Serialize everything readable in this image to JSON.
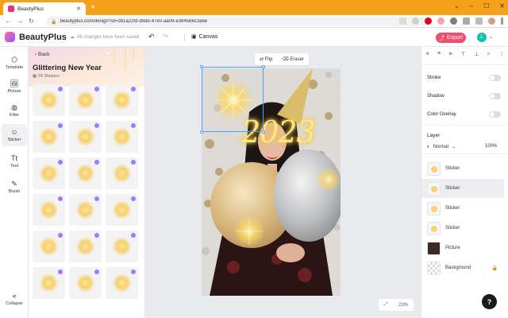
{
  "browser": {
    "tab_title": "BeautyPlus",
    "url": "beautyplus.com/design?id=3b1a22fd-d9a9-47e0-aa09-e3845b6c3a6e"
  },
  "app": {
    "name": "BeautyPlus",
    "saved_status": "All changes have been saved",
    "canvas_label": "Canvas",
    "export_label": "Export",
    "avatar_initial": "L"
  },
  "tools": {
    "template": "Template",
    "picture": "Picture",
    "filter": "Filter",
    "sticker": "Sticker",
    "text": "Text",
    "brush": "Brush",
    "collapse": "Collapse"
  },
  "sticker_panel": {
    "back_label": "Back",
    "title": "Glittering New Year",
    "count": "24 Stickers"
  },
  "canvas": {
    "flip_label": "Flip",
    "eraser_label": "Eraser",
    "zoom": "23%",
    "sticker_text": "2023"
  },
  "properties": {
    "stroke": "Stroke",
    "shadow": "Shadow",
    "color_overlay": "Color Overlay"
  },
  "layers": {
    "header": "Layer",
    "blend_mode": "Normal",
    "opacity": "100%",
    "items": [
      {
        "label": "Sticker"
      },
      {
        "label": "Sticker"
      },
      {
        "label": "Sticker"
      },
      {
        "label": "Sticker"
      },
      {
        "label": "Picture"
      },
      {
        "label": "Background"
      }
    ]
  },
  "help_label": "?",
  "colors": {
    "browser_frame": "#f5a11a",
    "export_button": "#ef4d6e",
    "avatar": "#1bbfb0",
    "selection": "#4aa3ff"
  }
}
